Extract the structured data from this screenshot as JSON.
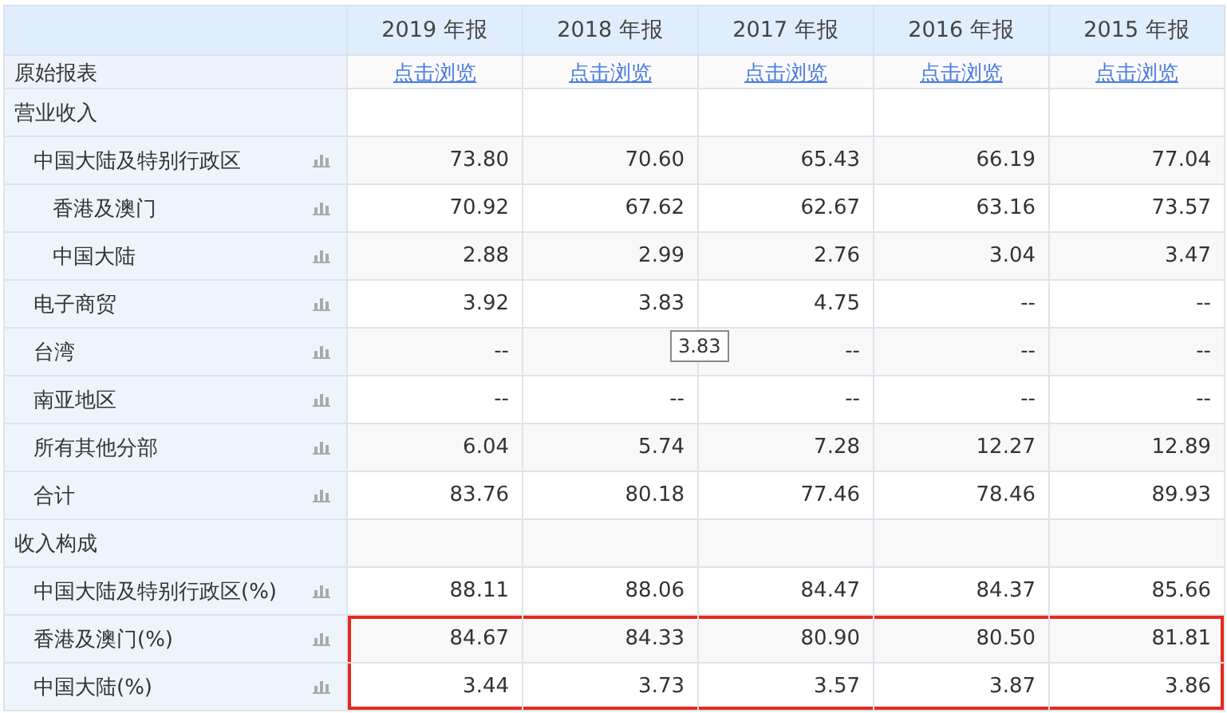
{
  "header": {
    "columns": [
      "2019 年报",
      "2018 年报",
      "2017 年报",
      "2016 年报",
      "2015 年报"
    ]
  },
  "report_row": {
    "label": "原始报表",
    "links": [
      "点击浏览",
      "点击浏览",
      "点击浏览",
      "点击浏览",
      "点击浏览"
    ]
  },
  "sections": [
    {
      "label": "营业收入",
      "children": [
        {
          "label": "中国大陆及特别行政区",
          "values": [
            "73.80",
            "70.60",
            "65.43",
            "66.19",
            "77.04"
          ],
          "highlighted": false,
          "children": [
            {
              "label": "香港及澳门",
              "values": [
                "70.92",
                "67.62",
                "62.67",
                "63.16",
                "73.57"
              ],
              "highlighted": false
            },
            {
              "label": "中国大陆",
              "values": [
                "2.88",
                "2.99",
                "2.76",
                "3.04",
                "3.47"
              ],
              "highlighted": false
            }
          ]
        },
        {
          "label": "电子商贸",
          "values": [
            "3.92",
            "3.83",
            "4.75",
            "--",
            "--"
          ],
          "highlighted": false
        },
        {
          "label": "台湾",
          "values": [
            "--",
            {
              "covered": true
            },
            "--",
            "--",
            "--"
          ],
          "highlighted": false
        },
        {
          "label": "南亚地区",
          "values": [
            "--",
            "--",
            "--",
            "--",
            "--"
          ],
          "highlighted": false
        },
        {
          "label": "所有其他分部",
          "values": [
            "6.04",
            "5.74",
            "7.28",
            "12.27",
            "12.89"
          ],
          "highlighted": false
        },
        {
          "label": "合计",
          "values": [
            "83.76",
            "80.18",
            "77.46",
            "78.46",
            "89.93"
          ],
          "highlighted": false
        }
      ]
    },
    {
      "label": "收入构成",
      "children": [
        {
          "label": "中国大陆及特别行政区(%)",
          "values": [
            "88.11",
            "88.06",
            "84.47",
            "84.37",
            "85.66"
          ],
          "highlighted": false
        },
        {
          "label": "香港及澳门(%)",
          "values": [
            "84.67",
            "84.33",
            "80.90",
            "80.50",
            "81.81"
          ],
          "highlighted": true
        },
        {
          "label": "中国大陆(%)",
          "values": [
            "3.44",
            "3.73",
            "3.57",
            "3.87",
            "3.86"
          ],
          "highlighted": true
        }
      ]
    }
  ],
  "tooltip": {
    "text": "3.83"
  }
}
